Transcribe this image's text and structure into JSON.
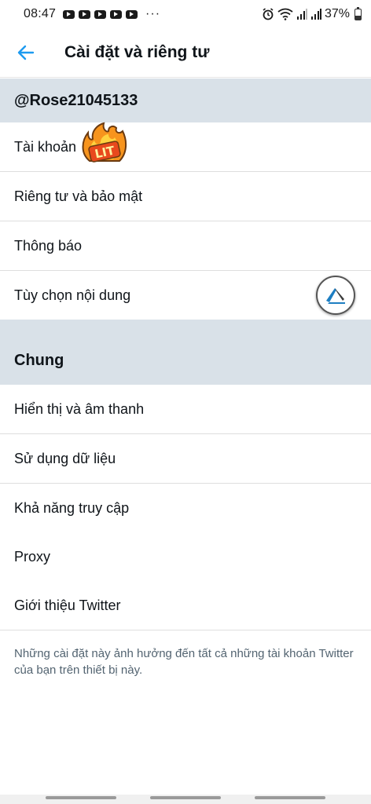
{
  "status_bar": {
    "time": "08:47",
    "more": "···",
    "battery": "37%",
    "battery_level": 0.37,
    "icons": [
      "youtube-icon",
      "youtube-icon",
      "youtube-icon",
      "youtube-icon",
      "youtube-icon",
      "alarm-icon",
      "wifi-icon",
      "signal-icon",
      "signal-icon",
      "battery-icon"
    ]
  },
  "header": {
    "title": "Cài đặt và riêng tư",
    "back_icon": "arrow-left-icon"
  },
  "account_section": {
    "username": "@Rose21045133",
    "items": [
      {
        "label": "Tài khoản"
      },
      {
        "label": "Riêng tư và bảo mật"
      },
      {
        "label": "Thông báo"
      },
      {
        "label": "Tùy chọn nội dung"
      }
    ]
  },
  "general_section": {
    "title": "Chung",
    "items": [
      {
        "label": "Hiển thị và âm thanh"
      },
      {
        "label": "Sử dụng dữ liệu"
      },
      {
        "label": "Khả năng truy cập"
      },
      {
        "label": "Proxy"
      },
      {
        "label": "Giới thiệu Twitter"
      }
    ]
  },
  "sticker": {
    "text": "LIT"
  },
  "footer_note": "Những cài đặt này ảnh hưởng đến tất cả những tài khoản Twitter của bạn trên thiết bị này.",
  "colors": {
    "accent": "#1d9bf0",
    "section_bg": "#d9e1e8",
    "text_primary": "#0f1419",
    "text_secondary": "#536471"
  }
}
